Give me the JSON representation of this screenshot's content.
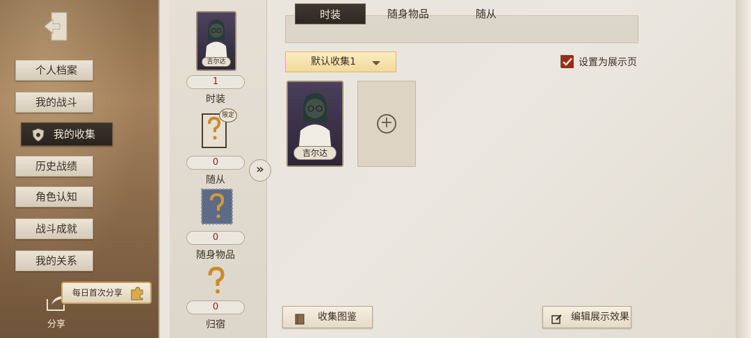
{
  "sidebar": {
    "items": [
      {
        "label": "个人档案"
      },
      {
        "label": "我的战斗"
      },
      {
        "label": "我的收集"
      },
      {
        "label": "历史战绩"
      },
      {
        "label": "角色认知"
      },
      {
        "label": "战斗成就"
      },
      {
        "label": "我的关系"
      }
    ],
    "active_index": 2,
    "share_badge": "每日首次分享",
    "share_label": "分享"
  },
  "column": {
    "character_name": "吉尔达",
    "sections": [
      {
        "count": "1",
        "label": "时装"
      },
      {
        "count": "0",
        "label": "随从",
        "badge": "限定"
      },
      {
        "count": "0",
        "label": "随身物品"
      },
      {
        "count": "0",
        "label": "归宿"
      }
    ]
  },
  "tabs": [
    {
      "label": "时装"
    },
    {
      "label": "随身物品"
    },
    {
      "label": "随从"
    }
  ],
  "active_tab": 0,
  "dropdown": {
    "value": "默认收集1"
  },
  "display_checkbox": {
    "label": "设置为展示页",
    "checked": true
  },
  "cards": [
    {
      "name": "吉尔达"
    }
  ],
  "footer": {
    "collection_guide": "收集图鉴",
    "edit_display": "编辑展示效果"
  },
  "colors": {
    "accent_gold": "#d8b767",
    "dark_tab": "#2d2722",
    "check_red": "#9a2a1a"
  }
}
